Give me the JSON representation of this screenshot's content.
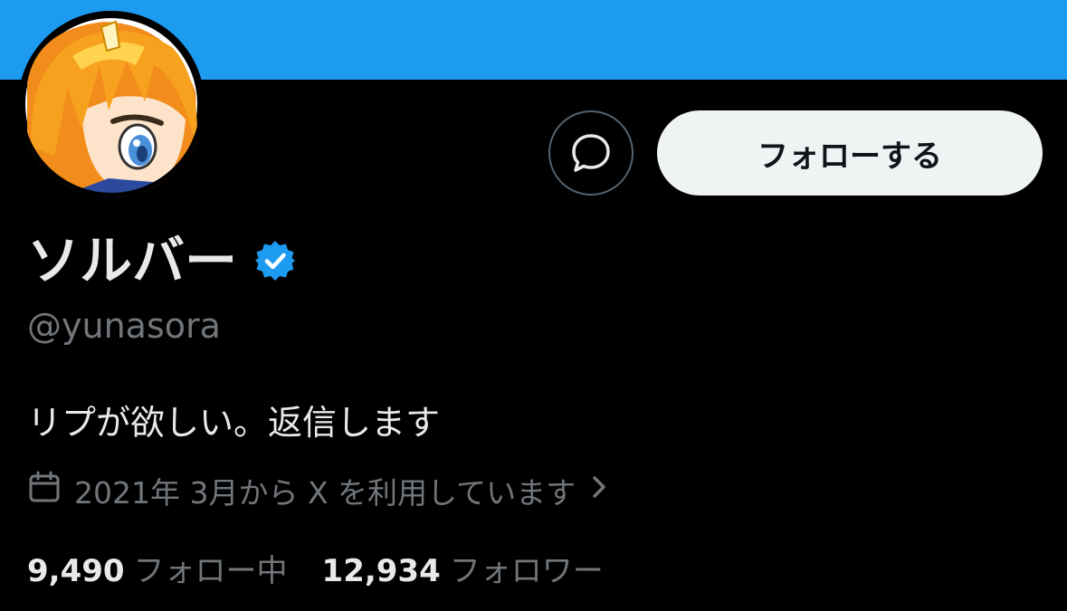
{
  "colors": {
    "banner": "#1d9bf0",
    "background": "#000000",
    "text_primary": "#e7e9ea",
    "text_secondary": "#71767b",
    "follow_button_bg": "#eff3f4",
    "verified_badge": "#1d9bf0"
  },
  "header": {
    "avatar_icon": "avatar-image",
    "message_icon": "message-bubble-icon",
    "follow_label": "フォローする"
  },
  "profile": {
    "display_name": "ソルバー",
    "verified": true,
    "handle": "@yunasora",
    "bio": "リプが欲しい。返信します",
    "joined_icon": "calendar-icon",
    "joined_text": "2021年 3月から X を利用しています",
    "joined_chevron": "chevron-right-icon"
  },
  "stats": {
    "following_count": "9,490",
    "following_label": "フォロー中",
    "followers_count": "12,934",
    "followers_label": "フォロワー"
  }
}
